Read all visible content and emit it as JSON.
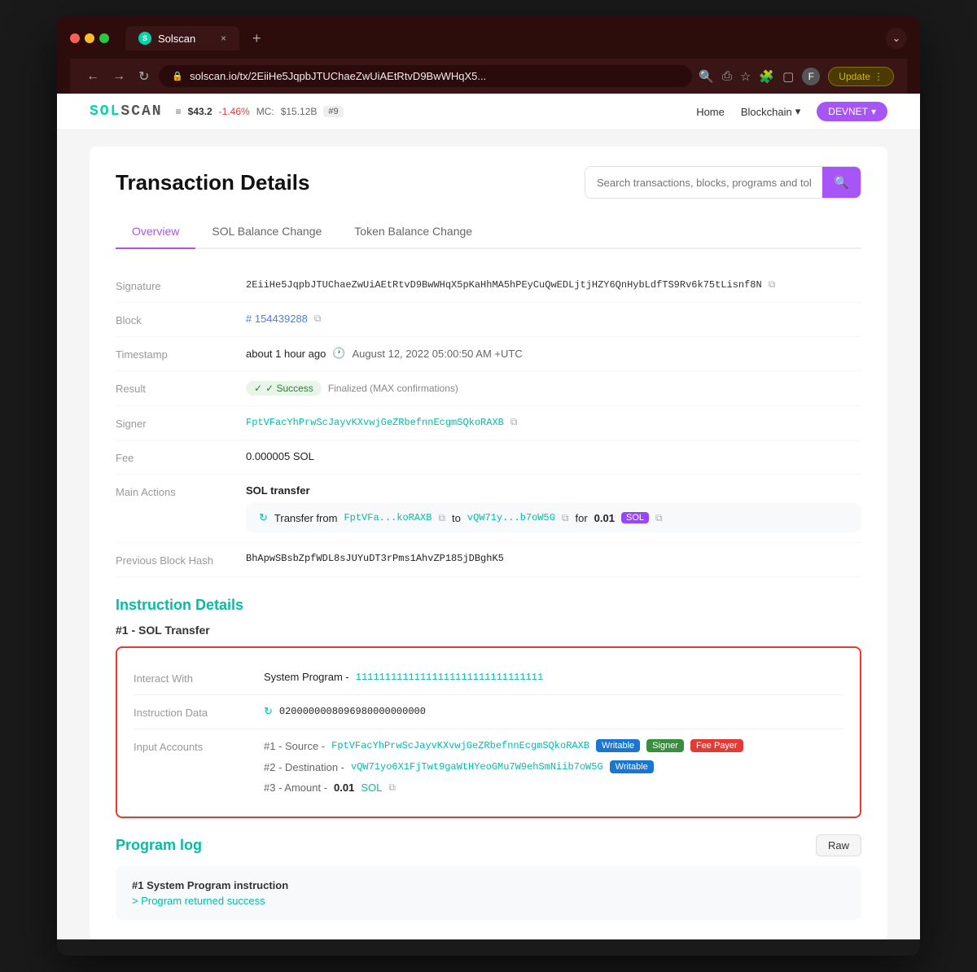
{
  "browser": {
    "tab_icon": "S",
    "tab_title": "Solscan",
    "tab_close": "×",
    "new_tab": "+",
    "more_icon": "⌄",
    "nav_back": "←",
    "nav_forward": "→",
    "nav_refresh": "↻",
    "lock_icon": "🔒",
    "address": "solscan.io/tx/2EiiHe5JqpbJTUChaeZwUiAEtRtvD9BwWHqX5...",
    "nav_search": "🔍",
    "nav_share": "⎙",
    "nav_bookmark": "☆",
    "nav_puzzle": "🧩",
    "nav_sidebar": "▢",
    "nav_profile": "F",
    "update_btn": "Update",
    "update_chevron": "⋮"
  },
  "site_header": {
    "logo": "SOLSCAN",
    "price": "$43.2",
    "price_change": "-1.46%",
    "market_cap_label": "MC:",
    "market_cap": "$15.12B",
    "rank": "#9",
    "nav_home": "Home",
    "nav_blockchain": "Blockchain",
    "nav_blockchain_arrow": "▾",
    "nav_devnet": "DEVNET",
    "nav_devnet_arrow": "▾"
  },
  "page": {
    "title": "Transaction Details",
    "search_placeholder": "Search transactions, blocks, programs and tokens",
    "search_icon": "🔍"
  },
  "tabs": [
    {
      "id": "overview",
      "label": "Overview",
      "active": true
    },
    {
      "id": "sol-balance-change",
      "label": "SOL Balance Change",
      "active": false
    },
    {
      "id": "token-balance-change",
      "label": "Token Balance Change",
      "active": false
    }
  ],
  "details": {
    "signature_label": "Signature",
    "signature_value": "2EiiHe5JqpbJTUChaeZwUiAEtRtvD9BwWHqX5pKaHhMA5hPEyCuQwEDLjtjHZY6QnHybLdfTS9Rv6k75tLisnf8N",
    "block_label": "Block",
    "block_value": "# 154439288",
    "timestamp_label": "Timestamp",
    "timestamp_ago": "about 1 hour ago",
    "timestamp_clock": "🕐",
    "timestamp_full": "August 12, 2022 05:00:50 AM +UTC",
    "result_label": "Result",
    "result_success": "✓ Success",
    "result_finalized": "Finalized (MAX confirmations)",
    "signer_label": "Signer",
    "signer_value": "FptVFacYhPrwScJayvKXvwjGeZRbefnnEcgmSQkoRAXB",
    "fee_label": "Fee",
    "fee_value": "0.000005 SOL",
    "main_actions_label": "Main Actions",
    "transfer_title": "SOL transfer",
    "transfer_refresh": "↻",
    "transfer_from_label": "Transfer from",
    "transfer_from": "FptVFa...koRAXB",
    "transfer_to_label": "to",
    "transfer_to": "vQW71y...b7oW5G",
    "transfer_for_label": "for",
    "transfer_amount": "0.01",
    "transfer_token": "SOL",
    "prev_block_label": "Previous Block Hash",
    "prev_block_value": "BhApwSBsbZpfWDL8sJUYuDT3rPms1AhvZP185jDBghK5"
  },
  "instruction_details": {
    "section_title": "Instruction Details",
    "instruction_num": "#1 - SOL Transfer",
    "interact_with_label": "Interact With",
    "interact_program": "System Program -",
    "interact_address": "11111111111111111111111111111111",
    "instruction_data_label": "Instruction Data",
    "instruction_data_icon": "↻",
    "instruction_data_value": "0200000008096980000000000",
    "input_accounts_label": "Input Accounts",
    "accounts": [
      {
        "num": "#1",
        "role_label": "Source",
        "address": "FptVFacYhPrwScJayvKXvwjGeZRbefnnEcgmSQkoRAXB",
        "badges": [
          "Writable",
          "Signer",
          "Fee Payer"
        ]
      },
      {
        "num": "#2",
        "role_label": "Destination",
        "address": "vQW71yo6X1FjTwt9gaWtHYeoGMu7W9ehSmNiib7oW5G",
        "badges": [
          "Writable"
        ]
      },
      {
        "num": "#3",
        "role_label": "Amount",
        "amount": "0.01",
        "token": "SOL"
      }
    ]
  },
  "program_log": {
    "section_title": "Program log",
    "raw_btn": "Raw",
    "log_title": "#1 System Program instruction",
    "log_result": "> Program returned success"
  }
}
